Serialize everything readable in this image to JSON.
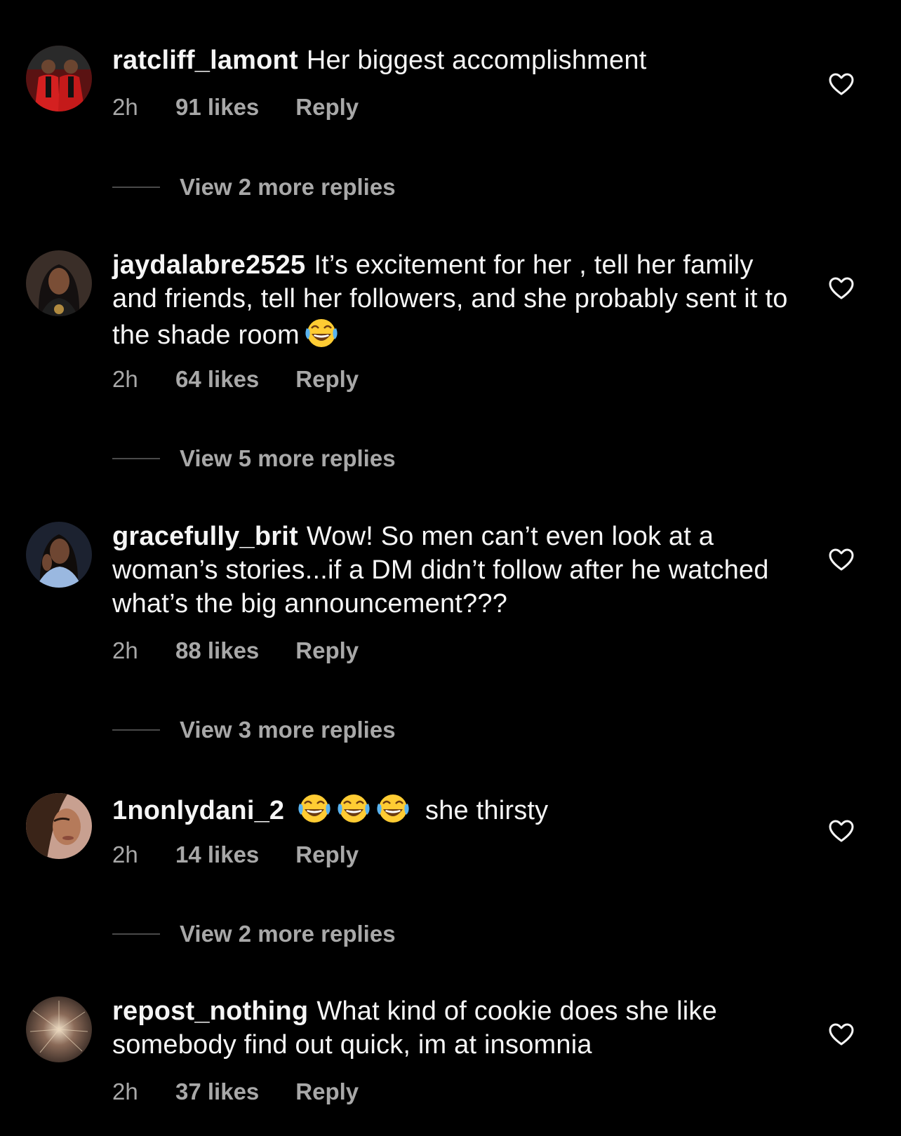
{
  "colors": {
    "background": "#000000",
    "primary_text": "#f5f5f5",
    "secondary_text": "#a8a8a8",
    "divider": "#4a4a4a"
  },
  "comments": [
    {
      "username": "ratcliff_lamont",
      "text": "Her biggest accomplishment",
      "emoji_count": 0,
      "time": "2h",
      "likes": "91 likes",
      "reply": "Reply",
      "view_replies": "View 2 more replies",
      "avatar": "avatar-red-suit"
    },
    {
      "username": "jaydalabre2525",
      "text": "It’s excitement for her , tell her family and friends, tell her followers, and she probably sent it to the shade room",
      "emoji_count": 1,
      "emoji": "laughing-tears-emoji",
      "time": "2h",
      "likes": "64 likes",
      "reply": "Reply",
      "view_replies": "View 5 more replies",
      "avatar": "avatar-woman-dark-hair"
    },
    {
      "username": "gracefully_brit",
      "text": "Wow! So men can’t even look at a woman’s stories...if a DM didn’t follow after he watched what’s the big announcement???",
      "emoji_count": 0,
      "time": "2h",
      "likes": "88 likes",
      "reply": "Reply",
      "view_replies": "View 3 more replies",
      "avatar": "avatar-woman-blue"
    },
    {
      "username": "1nonlydani_2",
      "text_after_emoji": "she thirsty",
      "emoji_count": 3,
      "emoji": "laughing-tears-emoji",
      "time": "2h",
      "likes": "14 likes",
      "reply": "Reply",
      "view_replies": "View 2 more replies",
      "avatar": "avatar-woman-selfie"
    },
    {
      "username": "repost_nothing",
      "text": "What kind of cookie does she like somebody find out quick, im at insomnia",
      "emoji_count": 0,
      "time": "2h",
      "likes": "37 likes",
      "reply": "Reply",
      "avatar": "avatar-firework"
    }
  ]
}
